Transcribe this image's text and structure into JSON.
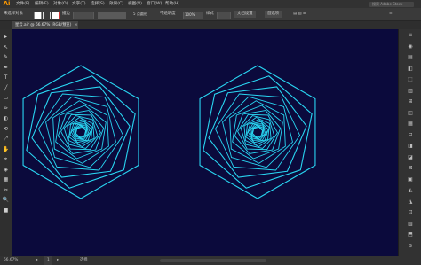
{
  "app": {
    "logo": "Ai"
  },
  "menu": {
    "items": [
      "文件(F)",
      "编辑(E)",
      "对象(O)",
      "文字(T)",
      "选择(S)",
      "效果(C)",
      "视图(V)",
      "窗口(W)",
      "帮助(H)"
    ],
    "search_placeholder": "搜索 Adobe Stock"
  },
  "control_bar": {
    "selection_label": "未选择对象",
    "stroke_label": "描边",
    "opacity_label": "不透明度",
    "opacity_value": "100%",
    "style_label": "样式",
    "doc_setup_label": "文档设置",
    "preferences_label": "首选项",
    "brush_label": "5 点圆形"
  },
  "document": {
    "tab_title": "星云.ai* @ 66.67% (RGB/预览)",
    "close_glyph": "×"
  },
  "tools": [
    "▸",
    "↖",
    "✎",
    "✒",
    "T",
    "╱",
    "▭",
    "✏",
    "◐",
    "⟲",
    "⤢",
    "✋",
    "⌖",
    "◈",
    "▦",
    "✂",
    "🔍",
    "■"
  ],
  "right_panel_icons": [
    "≡",
    "◉",
    "▤",
    "◧",
    "⬚",
    "▥",
    "⊞",
    "◫",
    "▦",
    "⊟",
    "◨",
    "◪",
    "⊠",
    "▣",
    "◭",
    "◮",
    "⊡",
    "▧",
    "⬒",
    "⊕"
  ],
  "status": {
    "zoom": "66.67%",
    "page": "1",
    "mode": "选择"
  },
  "colors": {
    "artboard_bg": "#0b0a3c",
    "swirl_stroke": "#29d6f2",
    "ui_bg": "#2b2b2b"
  }
}
